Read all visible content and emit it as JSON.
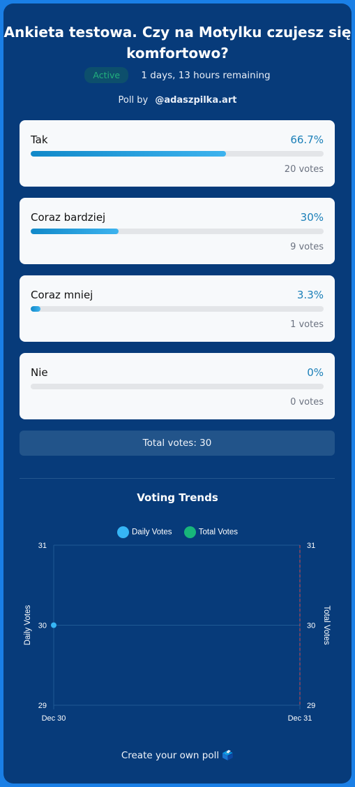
{
  "poll": {
    "title_line1": "Ankieta testowa. Czy na Motylku czujesz się",
    "title_line2": "komfortowo?",
    "status": "Active",
    "remaining": "1 days, 13 hours remaining",
    "poll_by_label": "Poll by",
    "author": "@adaszpilka.art",
    "options": [
      {
        "label": "Tak",
        "percent_text": "66.7%",
        "percent": 66.7,
        "votes_text": "20 votes"
      },
      {
        "label": "Coraz bardziej",
        "percent_text": "30%",
        "percent": 30,
        "votes_text": "9 votes"
      },
      {
        "label": "Coraz mniej",
        "percent_text": "3.3%",
        "percent": 3.3,
        "votes_text": "1 votes"
      },
      {
        "label": "Nie",
        "percent_text": "0%",
        "percent": 0,
        "votes_text": "0 votes"
      }
    ],
    "total_votes": "Total votes: 30"
  },
  "trends": {
    "title": "Voting Trends"
  },
  "chart_data": {
    "type": "line",
    "x": [
      "Dec 30",
      "Dec 31"
    ],
    "series": [
      {
        "name": "Daily Votes",
        "axis": "left",
        "values": [
          30,
          null
        ],
        "color": "#36b5f5"
      },
      {
        "name": "Total Votes",
        "axis": "right",
        "values": [
          null,
          null
        ],
        "color": "#18b67a"
      }
    ],
    "ylabel_left": "Daily Votes",
    "ylabel_right": "Total Votes",
    "ylim": [
      29,
      31
    ],
    "yticks": [
      "31",
      "30",
      "29"
    ],
    "legend": "top",
    "grid": true,
    "marker_line_color": "#d94a4a"
  },
  "footer": {
    "text": "Create your own poll 🗳️"
  }
}
